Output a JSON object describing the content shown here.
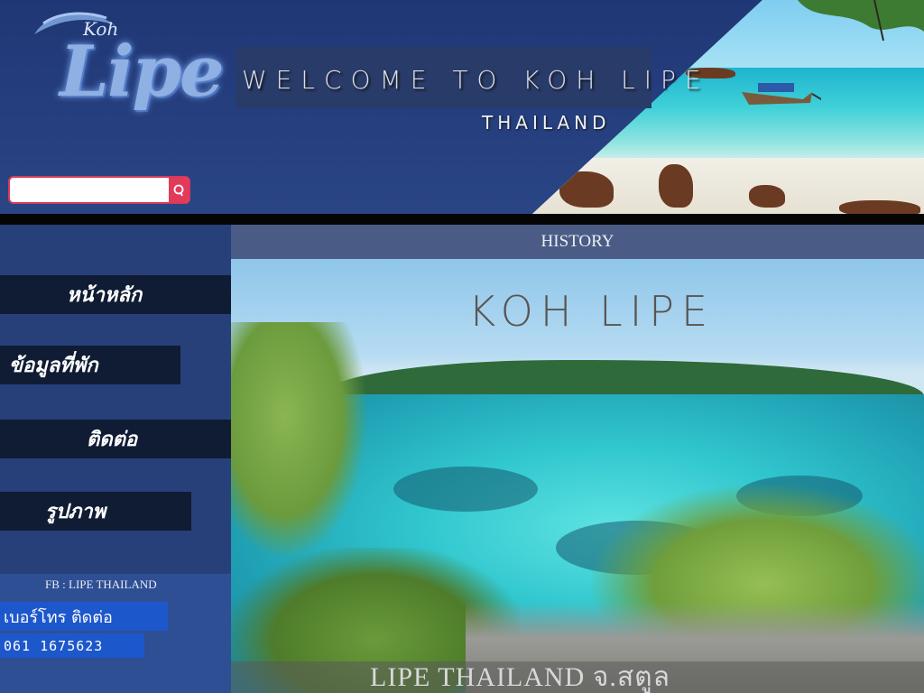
{
  "header": {
    "logo": {
      "small": "Koh",
      "large": "Lipe"
    },
    "welcome_title": "WELCOME TO KOH LIPE",
    "welcome_subtitle": "THAILAND"
  },
  "search": {
    "value": "",
    "placeholder": "",
    "icon": "search-icon"
  },
  "sidebar": {
    "items": [
      {
        "label": "หน้าหลัก"
      },
      {
        "label": "ข้อมูลที่พัก"
      },
      {
        "label": "ติดต่อ"
      },
      {
        "label": "รูปภาพ"
      }
    ],
    "fb": "FB : LIPE THAILAND",
    "phone_label": "เบอร์โทร ติดต่อ",
    "phone_number": "061 1675623"
  },
  "main": {
    "section_title": "HISTORY",
    "hero_title": "KOH LIPE",
    "caption": "LIPE THAILAND จ.สตูล"
  },
  "colors": {
    "background": "#27407a",
    "nav_item": "#101c33",
    "phone_box": "#1d57cc",
    "search_accent": "#e23a5a",
    "history_bar": "#4a5c85"
  }
}
